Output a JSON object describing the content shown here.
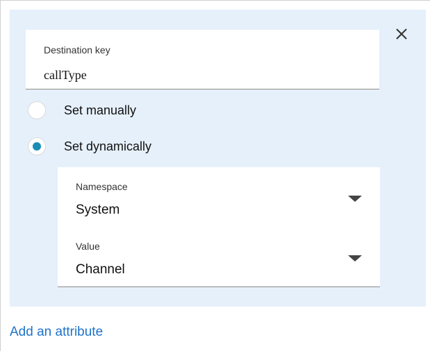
{
  "close": {
    "icon": "close-icon"
  },
  "destination_key": {
    "label": "Destination key",
    "value": "callType"
  },
  "options": {
    "manual_label": "Set manually",
    "dynamic_label": "Set dynamically",
    "selected": "Set dynamically"
  },
  "namespace": {
    "label": "Namespace",
    "value": "System",
    "icon": "caret-down-icon"
  },
  "value_field": {
    "label": "Value",
    "value": "Channel",
    "icon": "caret-down-icon"
  },
  "footer": {
    "add_attribute_label": "Add an attribute"
  },
  "colors": {
    "panel_bg": "#e6f0fb",
    "radio_selected": "#1a8db6",
    "link": "#1f73c9"
  }
}
